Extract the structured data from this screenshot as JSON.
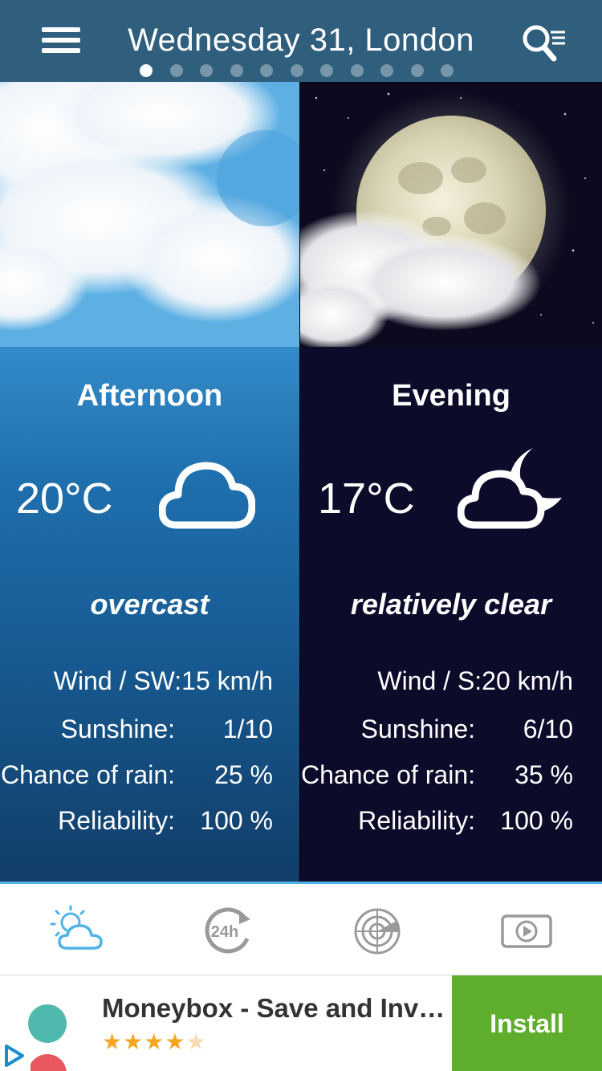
{
  "header": {
    "title": "Wednesday 31, London",
    "page_count": 11,
    "active_page": 0
  },
  "panels": {
    "afternoon": {
      "period": "Afternoon",
      "temperature": "20°C",
      "condition": "overcast",
      "condition_icon": "cloud-icon",
      "stats": [
        {
          "label": "Wind / SW:15 km/h",
          "value": ""
        },
        {
          "label": "Sunshine:",
          "value": "1/10"
        },
        {
          "label": "Chance of rain:",
          "value": "25 %"
        },
        {
          "label": "Reliability:",
          "value": "100 %"
        }
      ]
    },
    "evening": {
      "period": "Evening",
      "temperature": "17°C",
      "condition": "relatively clear",
      "condition_icon": "moon-cloud-icon",
      "stats": [
        {
          "label": "Wind / S:20 km/h",
          "value": ""
        },
        {
          "label": "Sunshine:",
          "value": "6/10"
        },
        {
          "label": "Chance of rain:",
          "value": "35 %"
        },
        {
          "label": "Reliability:",
          "value": "100 %"
        }
      ]
    }
  },
  "tabs": [
    {
      "icon": "weather-forecast-icon",
      "active": true
    },
    {
      "icon": "24h-icon",
      "active": false
    },
    {
      "icon": "radar-icon",
      "active": false
    },
    {
      "icon": "video-icon",
      "active": false
    }
  ],
  "ad": {
    "title": "Moneybox - Save and Invest",
    "rating": 4,
    "rating_max": 5,
    "install_label": "Install"
  },
  "colors": {
    "header_bg": "#2f5f7d",
    "accent": "#4fb3e8",
    "install_bg": "#5fad2c",
    "star": "#f4a623"
  }
}
